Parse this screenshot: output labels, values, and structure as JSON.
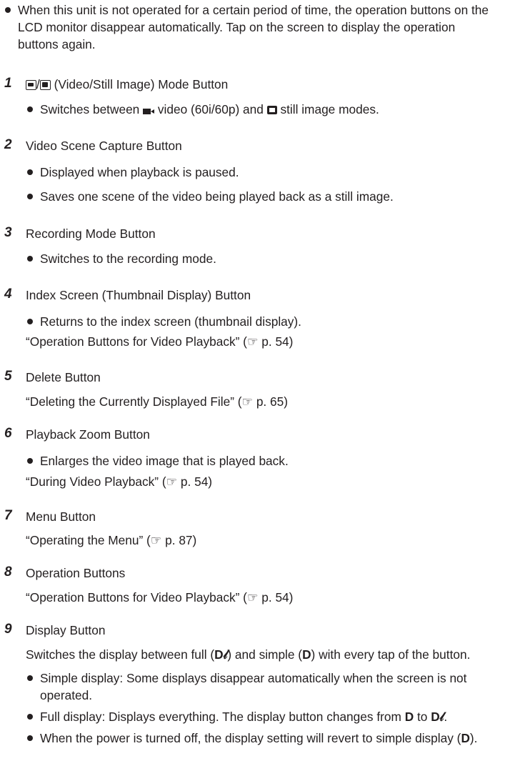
{
  "intro": "When this unit is not operated for a certain period of time, the operation buttons on the LCD monitor disappear automatically. Tap on the screen to display the operation buttons again.",
  "items": [
    {
      "num": "1",
      "head_suffix": " (Video/Still Image) Mode Button",
      "bullets_prefix": "Switches between ",
      "video_word": " video (60i/60p) and ",
      "still_word": " still image modes."
    },
    {
      "num": "2",
      "head": "Video Scene Capture Button",
      "bullets": [
        "Displayed when playback is paused.",
        "Saves one scene of the video being played back as a still image."
      ]
    },
    {
      "num": "3",
      "head": "Recording Mode Button",
      "bullets": [
        "Switches to the recording mode."
      ]
    },
    {
      "num": "4",
      "head": "Index Screen (Thumbnail Display) Button",
      "bullets": [
        "Returns to the index screen (thumbnail display)."
      ],
      "ref": "“Operation Buttons for Video Playback” (☞ p. 54)"
    },
    {
      "num": "5",
      "head": "Delete Button",
      "ref": "“Deleting the Currently Displayed File” (☞ p. 65)"
    },
    {
      "num": "6",
      "head": "Playback Zoom Button",
      "bullets": [
        "Enlarges the video image that is played back."
      ],
      "ref": "“During Video Playback” (☞ p. 54)"
    },
    {
      "num": "7",
      "head": "Menu Button",
      "ref": "“Operating the Menu” (☞ p. 87)"
    },
    {
      "num": "8",
      "head": "Operation Buttons",
      "ref": "“Operation Buttons for Video Playback” (☞ p. 54)"
    },
    {
      "num": "9",
      "head": "Display Button",
      "para_a": "Switches the display between full (",
      "full_sym": "D𝓁",
      "para_b": ") and simple (",
      "simple_sym": "D",
      "para_c": ") with every tap of the button.",
      "bullet1": "Simple display: Some displays disappear automatically when the screen is not operated.",
      "bullet2_a": "Full display: Displays everything. The display button changes from ",
      "bullet2_b": " to ",
      "bullet2_c": ".",
      "bullet3_a": "When the power is turned off, the display setting will revert to simple display (",
      "bullet3_b": ")."
    }
  ]
}
